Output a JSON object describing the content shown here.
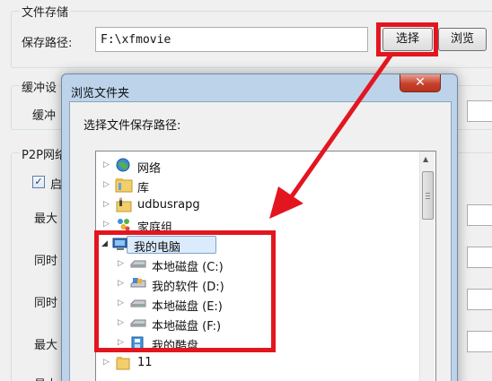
{
  "settings": {
    "file_storage": {
      "group_title": "文件存储",
      "path_label": "保存路径:",
      "path_value": "F:\\xfmovie",
      "select_button": "选择",
      "browse_button": "浏览"
    },
    "cache_group": {
      "title": "缓冲设",
      "row_label": "缓冲"
    },
    "p2p_group": {
      "title": "P2P网络",
      "checkbox_label": "启",
      "row_labels": [
        "最大",
        "同时",
        "同时",
        "最大",
        "最大"
      ]
    }
  },
  "dialog": {
    "title": "浏览文件夹",
    "close_glyph": "✕",
    "prompt": "选择文件保存路径:",
    "tree": [
      {
        "label": "网络",
        "icon": "network-globe-icon",
        "expander": "▷"
      },
      {
        "label": "库",
        "icon": "library-folder-icon",
        "expander": "▷"
      },
      {
        "label": "udbusrapg",
        "icon": "user-folder-icon",
        "expander": "▷"
      },
      {
        "label": "家庭组",
        "icon": "homegroup-icon",
        "expander": "▷"
      },
      {
        "label": "我的电脑",
        "icon": "computer-icon",
        "expander": "◢"
      },
      {
        "label": "本地磁盘 (C:)",
        "icon": "hard-drive-icon",
        "expander": "▷"
      },
      {
        "label": "我的软件 (D:)",
        "icon": "software-drive-icon",
        "expander": "▷"
      },
      {
        "label": "本地磁盘 (E:)",
        "icon": "hard-drive-icon",
        "expander": "▷"
      },
      {
        "label": "本地磁盘 (F:)",
        "icon": "hard-drive-icon",
        "expander": "▷"
      },
      {
        "label": "我的酷盘",
        "icon": "cloud-disk-icon",
        "expander": "▷"
      },
      {
        "label": "11",
        "icon": "folder-icon",
        "expander": "▷"
      }
    ]
  },
  "annotation": {
    "highlight_color": "#e3161f"
  },
  "icons": {
    "scroll_up": "▲"
  }
}
